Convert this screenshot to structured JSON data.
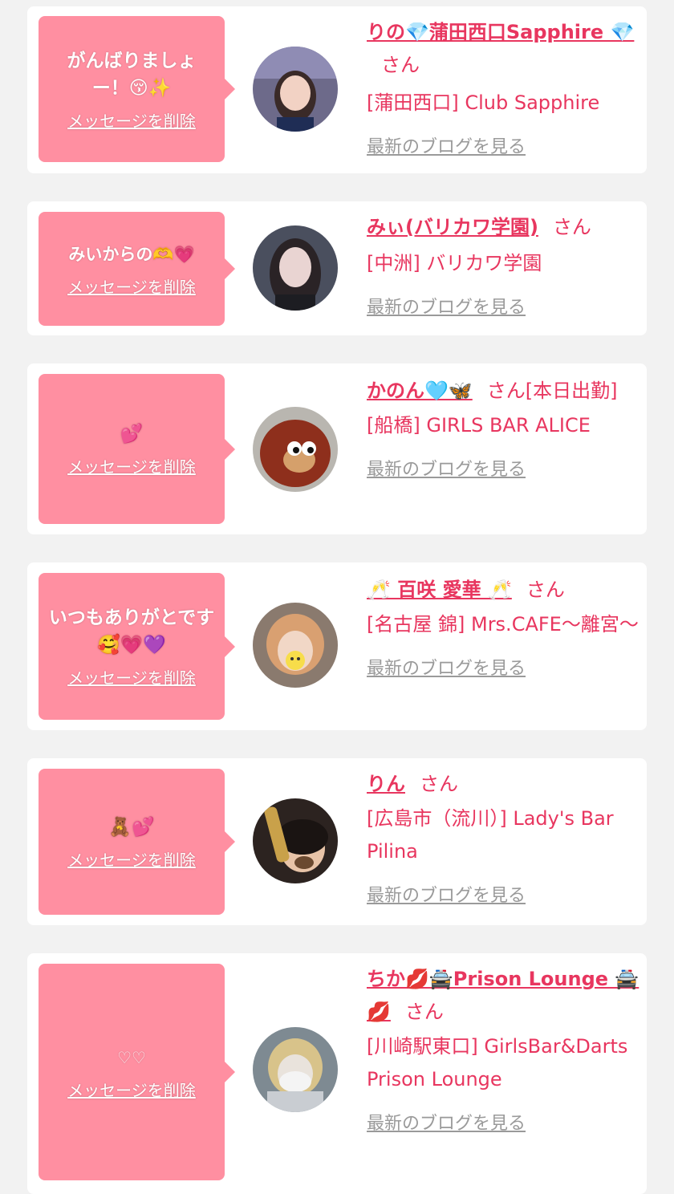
{
  "delete_label": "メッセージを削除",
  "blog_label": "最新のブログを見る",
  "san_label": "さん",
  "colors": {
    "accent": "#e8365f",
    "bubble": "#ff8fa1",
    "background": "#f2f2f2"
  },
  "cards": [
    {
      "message": "がんばりましょー！😚✨",
      "name": "りの💎蒲田西口Sapphire 💎",
      "shop": "[蒲田西口] Club Sapphire",
      "avatar_icon": "woman-photo-1"
    },
    {
      "message": "みいからの🫶💗",
      "name": "みぃ(バリカワ学園)",
      "shop": "[中洲] バリカワ学園",
      "avatar_icon": "woman-photo-2"
    },
    {
      "message": "💕",
      "name": "かのん🩵🦋",
      "tag": "[本日出勤]",
      "shop": "[船橋] GIRLS BAR ALICE",
      "avatar_icon": "monkey-puppet-photo"
    },
    {
      "message": "いつもありがとです🥰💗💜",
      "name": "🥂 百咲 愛華 🥂",
      "shop": "[名古屋 錦] Mrs.CAFE〜離宮〜",
      "avatar_icon": "woman-photo-3"
    },
    {
      "message": "🧸💕",
      "name": "りん",
      "shop": "[広島市（流川）] Lady's Bar Pilina",
      "avatar_icon": "woman-photo-4"
    },
    {
      "message": "♡♡",
      "name": "ちか💋🚔Prison Lounge 🚔💋",
      "shop": "[川崎駅東口] GirlsBar&Darts Prison Lounge",
      "avatar_icon": "woman-photo-5"
    }
  ]
}
